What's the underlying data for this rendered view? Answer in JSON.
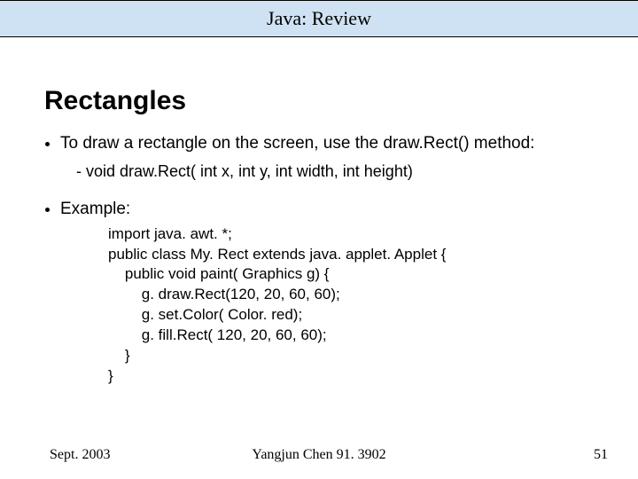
{
  "titlebar": "Java: Review",
  "heading": "Rectangles",
  "bullet1": "To draw a rectangle on the screen, use the draw.Rect() method:",
  "sub1": "void draw.Rect( int x, int y, int width, int height)",
  "bullet2": "Example:",
  "code": "import java. awt. *;\npublic class My. Rect extends java. applet. Applet {\n    public void paint( Graphics g) {\n        g. draw.Rect(120, 20, 60, 60);\n        g. set.Color( Color. red);\n        g. fill.Rect( 120, 20, 60, 60);\n    }\n}",
  "footer": {
    "left": "Sept. 2003",
    "center": "Yangjun Chen        91. 3902",
    "right": "51"
  }
}
